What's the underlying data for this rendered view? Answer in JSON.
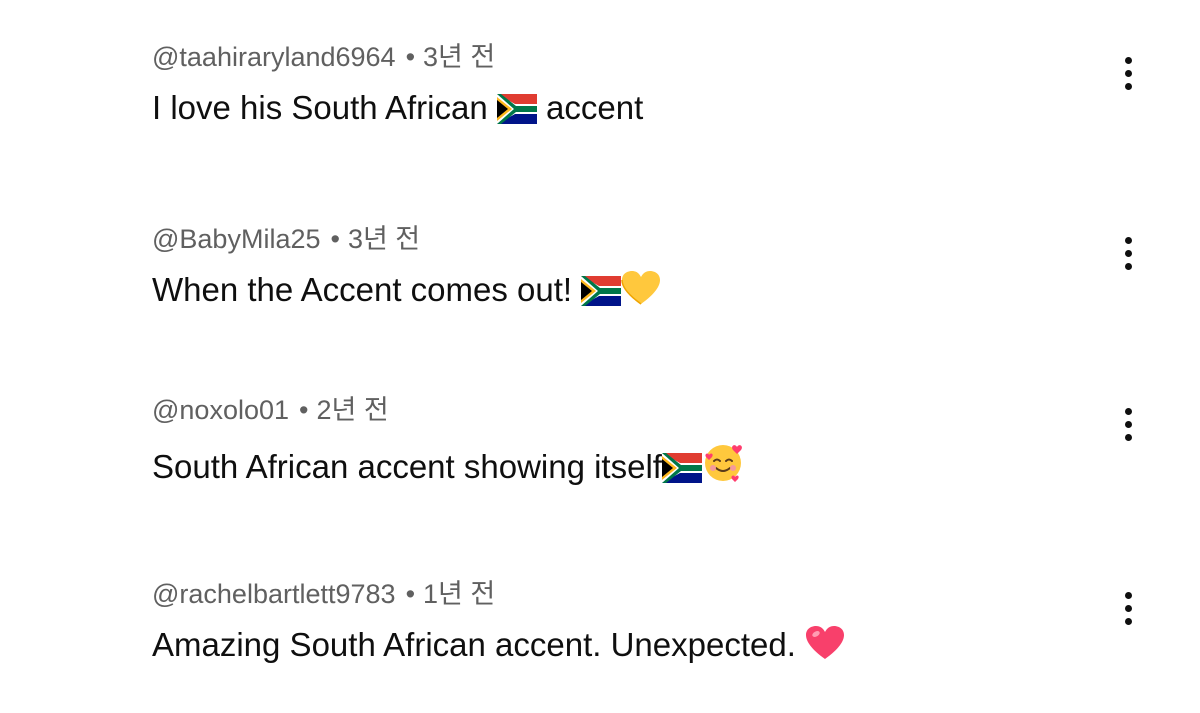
{
  "comments": [
    {
      "author": "@taahiraryland6964",
      "separator": "•",
      "time": "3년 전",
      "text": "I love his South African ",
      "text_after": " accent",
      "emojis": [
        "south-africa-flag-icon"
      ]
    },
    {
      "author": "@BabyMila25",
      "separator": "•",
      "time": "3년 전",
      "text": "When the Accent comes out! ",
      "text_after": "",
      "emojis": [
        "south-africa-flag-icon",
        "yellow-heart-icon"
      ]
    },
    {
      "author": "@noxolo01",
      "separator": "•",
      "time": "2년 전",
      "text": "South African accent showing itself",
      "text_after": "",
      "emojis": [
        "south-africa-flag-icon",
        "smiling-face-with-hearts-icon"
      ]
    },
    {
      "author": "@rachelbartlett9783",
      "separator": "•",
      "time": "1년 전",
      "text": "Amazing South African accent. Unexpected. ",
      "text_after": "",
      "emojis": [
        "red-heart-icon"
      ]
    }
  ],
  "colors": {
    "meta_text": "#606060",
    "body_text": "#0f0f0f",
    "background": "#ffffff"
  }
}
